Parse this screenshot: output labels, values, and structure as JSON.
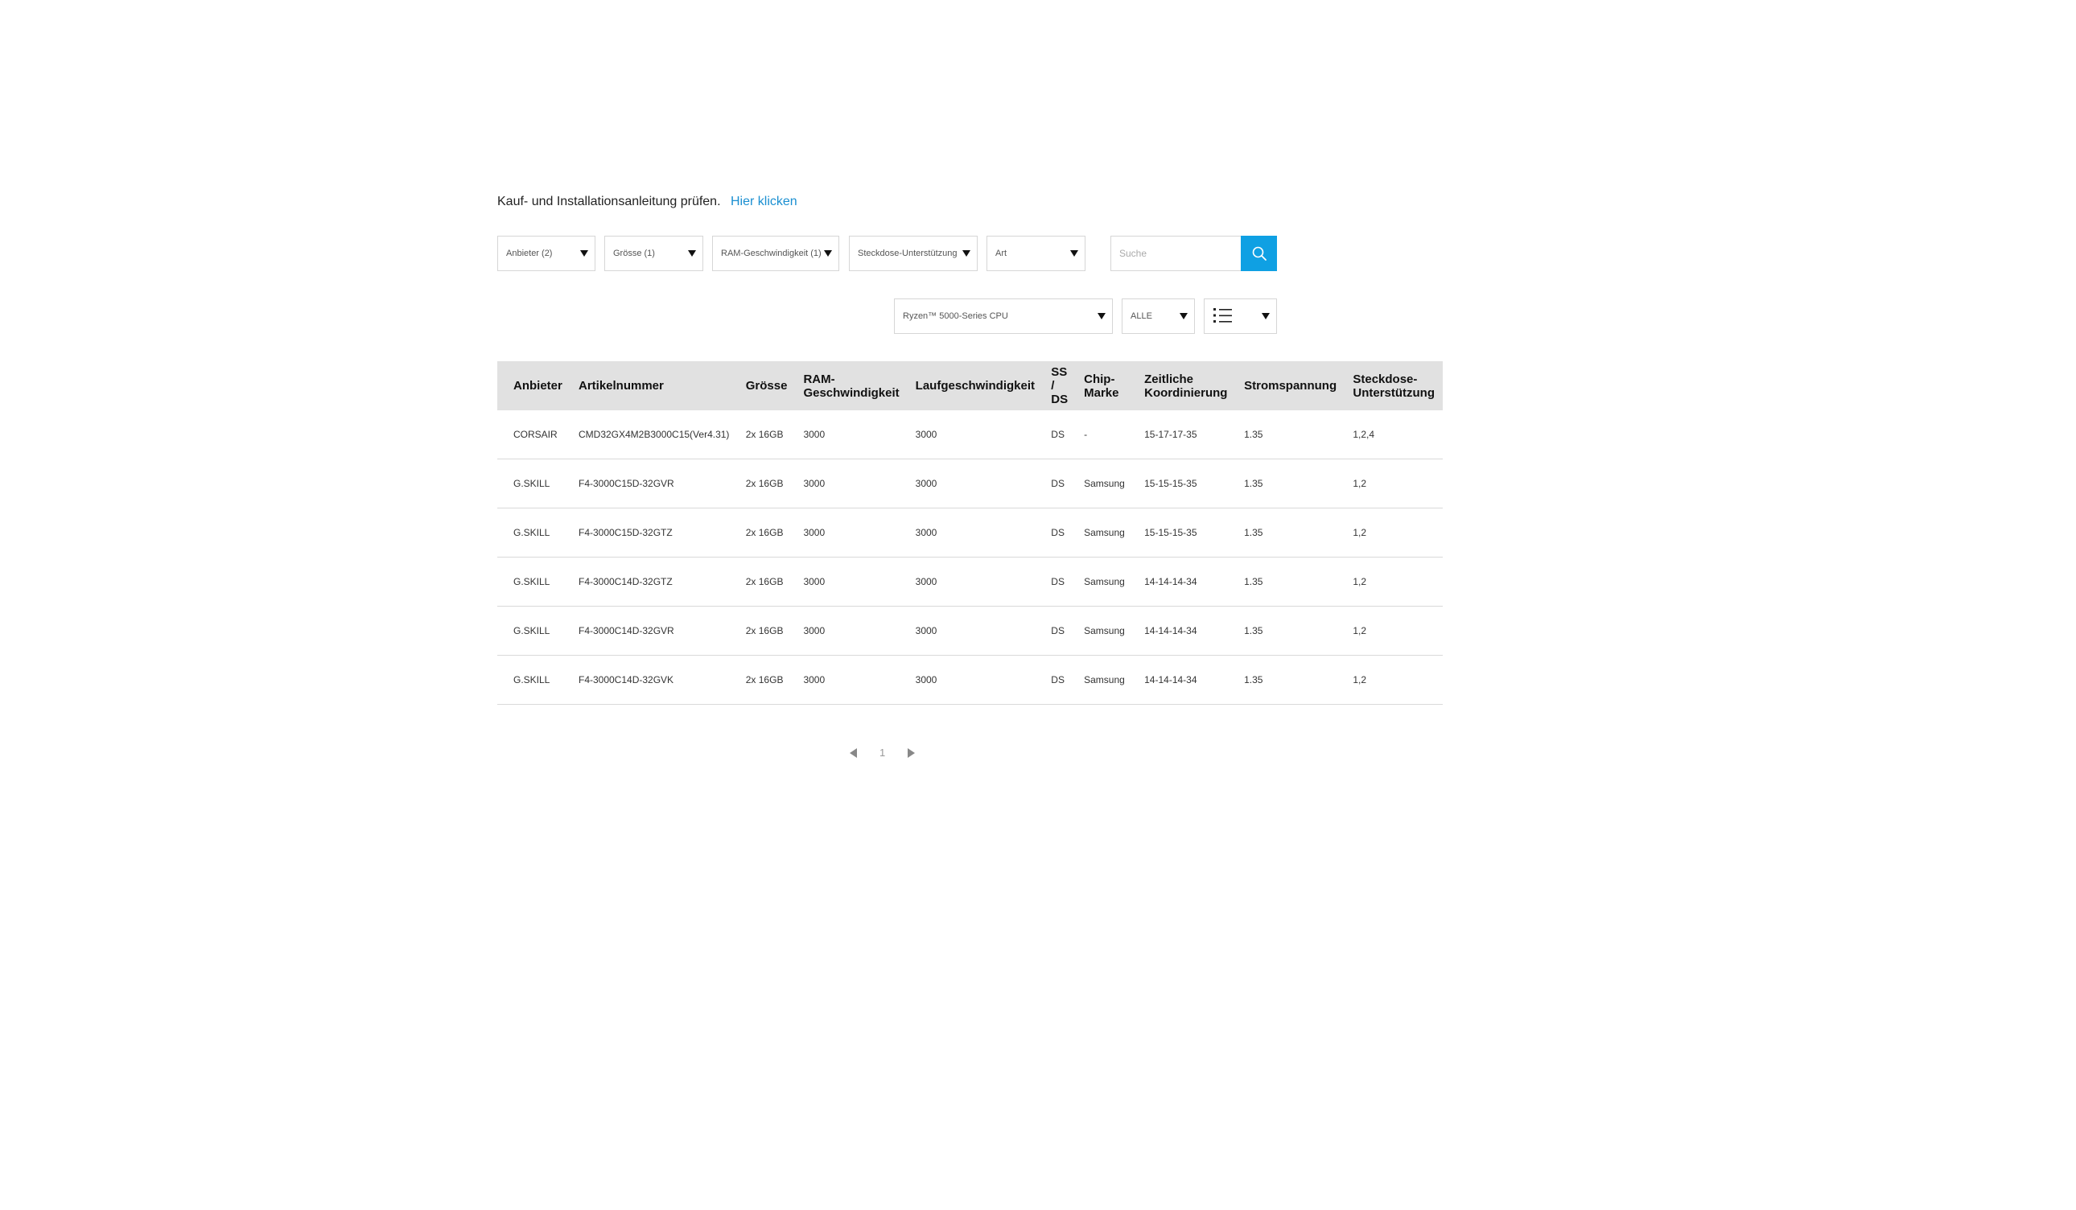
{
  "guide": {
    "text": "Kauf- und Installationsanleitung prüfen.",
    "link": "Hier klicken"
  },
  "filters": {
    "vendor": "Anbieter (2)",
    "size": "Grösse (1)",
    "ram_speed": "RAM-Geschwindigkeit (1)",
    "socket": "Steckdose-Unterstützung",
    "type": "Art"
  },
  "search": {
    "placeholder": "Suche"
  },
  "platform": {
    "cpu": "Ryzen™ 5000-Series CPU",
    "scope": "ALLE",
    "view_icon": "list-icon"
  },
  "table": {
    "headers": {
      "vendor": "Anbieter",
      "part": "Artikelnummer",
      "size": "Grösse",
      "ram_speed": "RAM-Geschwindigkeit",
      "run_speed": "Laufgeschwindigkeit",
      "ssds": "SS / DS",
      "chip": "Chip-Marke",
      "timing": "Zeitliche Koordinierung",
      "voltage": "Stromspannung",
      "socket": "Steckdose-Unterstützung"
    },
    "rows": [
      {
        "vendor": "CORSAIR",
        "part": "CMD32GX4M2B3000C15(Ver4.31)",
        "size": "2x 16GB",
        "ram_speed": "3000",
        "run_speed": "3000",
        "ssds": "DS",
        "chip": "-",
        "timing": "15-17-17-35",
        "voltage": "1.35",
        "socket": "1,2,4"
      },
      {
        "vendor": "G.SKILL",
        "part": "F4-3000C15D-32GVR",
        "size": "2x 16GB",
        "ram_speed": "3000",
        "run_speed": "3000",
        "ssds": "DS",
        "chip": "Samsung",
        "timing": "15-15-15-35",
        "voltage": "1.35",
        "socket": "1,2"
      },
      {
        "vendor": "G.SKILL",
        "part": "F4-3000C15D-32GTZ",
        "size": "2x 16GB",
        "ram_speed": "3000",
        "run_speed": "3000",
        "ssds": "DS",
        "chip": "Samsung",
        "timing": "15-15-15-35",
        "voltage": "1.35",
        "socket": "1,2"
      },
      {
        "vendor": "G.SKILL",
        "part": "F4-3000C14D-32GTZ",
        "size": "2x 16GB",
        "ram_speed": "3000",
        "run_speed": "3000",
        "ssds": "DS",
        "chip": "Samsung",
        "timing": "14-14-14-34",
        "voltage": "1.35",
        "socket": "1,2"
      },
      {
        "vendor": "G.SKILL",
        "part": "F4-3000C14D-32GVR",
        "size": "2x 16GB",
        "ram_speed": "3000",
        "run_speed": "3000",
        "ssds": "DS",
        "chip": "Samsung",
        "timing": "14-14-14-34",
        "voltage": "1.35",
        "socket": "1,2"
      },
      {
        "vendor": "G.SKILL",
        "part": "F4-3000C14D-32GVK",
        "size": "2x 16GB",
        "ram_speed": "3000",
        "run_speed": "3000",
        "ssds": "DS",
        "chip": "Samsung",
        "timing": "14-14-14-34",
        "voltage": "1.35",
        "socket": "1,2"
      }
    ]
  },
  "pagination": {
    "current": "1"
  },
  "colors": {
    "accent": "#0fa0e3",
    "link": "#1a8fd1",
    "header_bg": "#e1e1e1"
  }
}
